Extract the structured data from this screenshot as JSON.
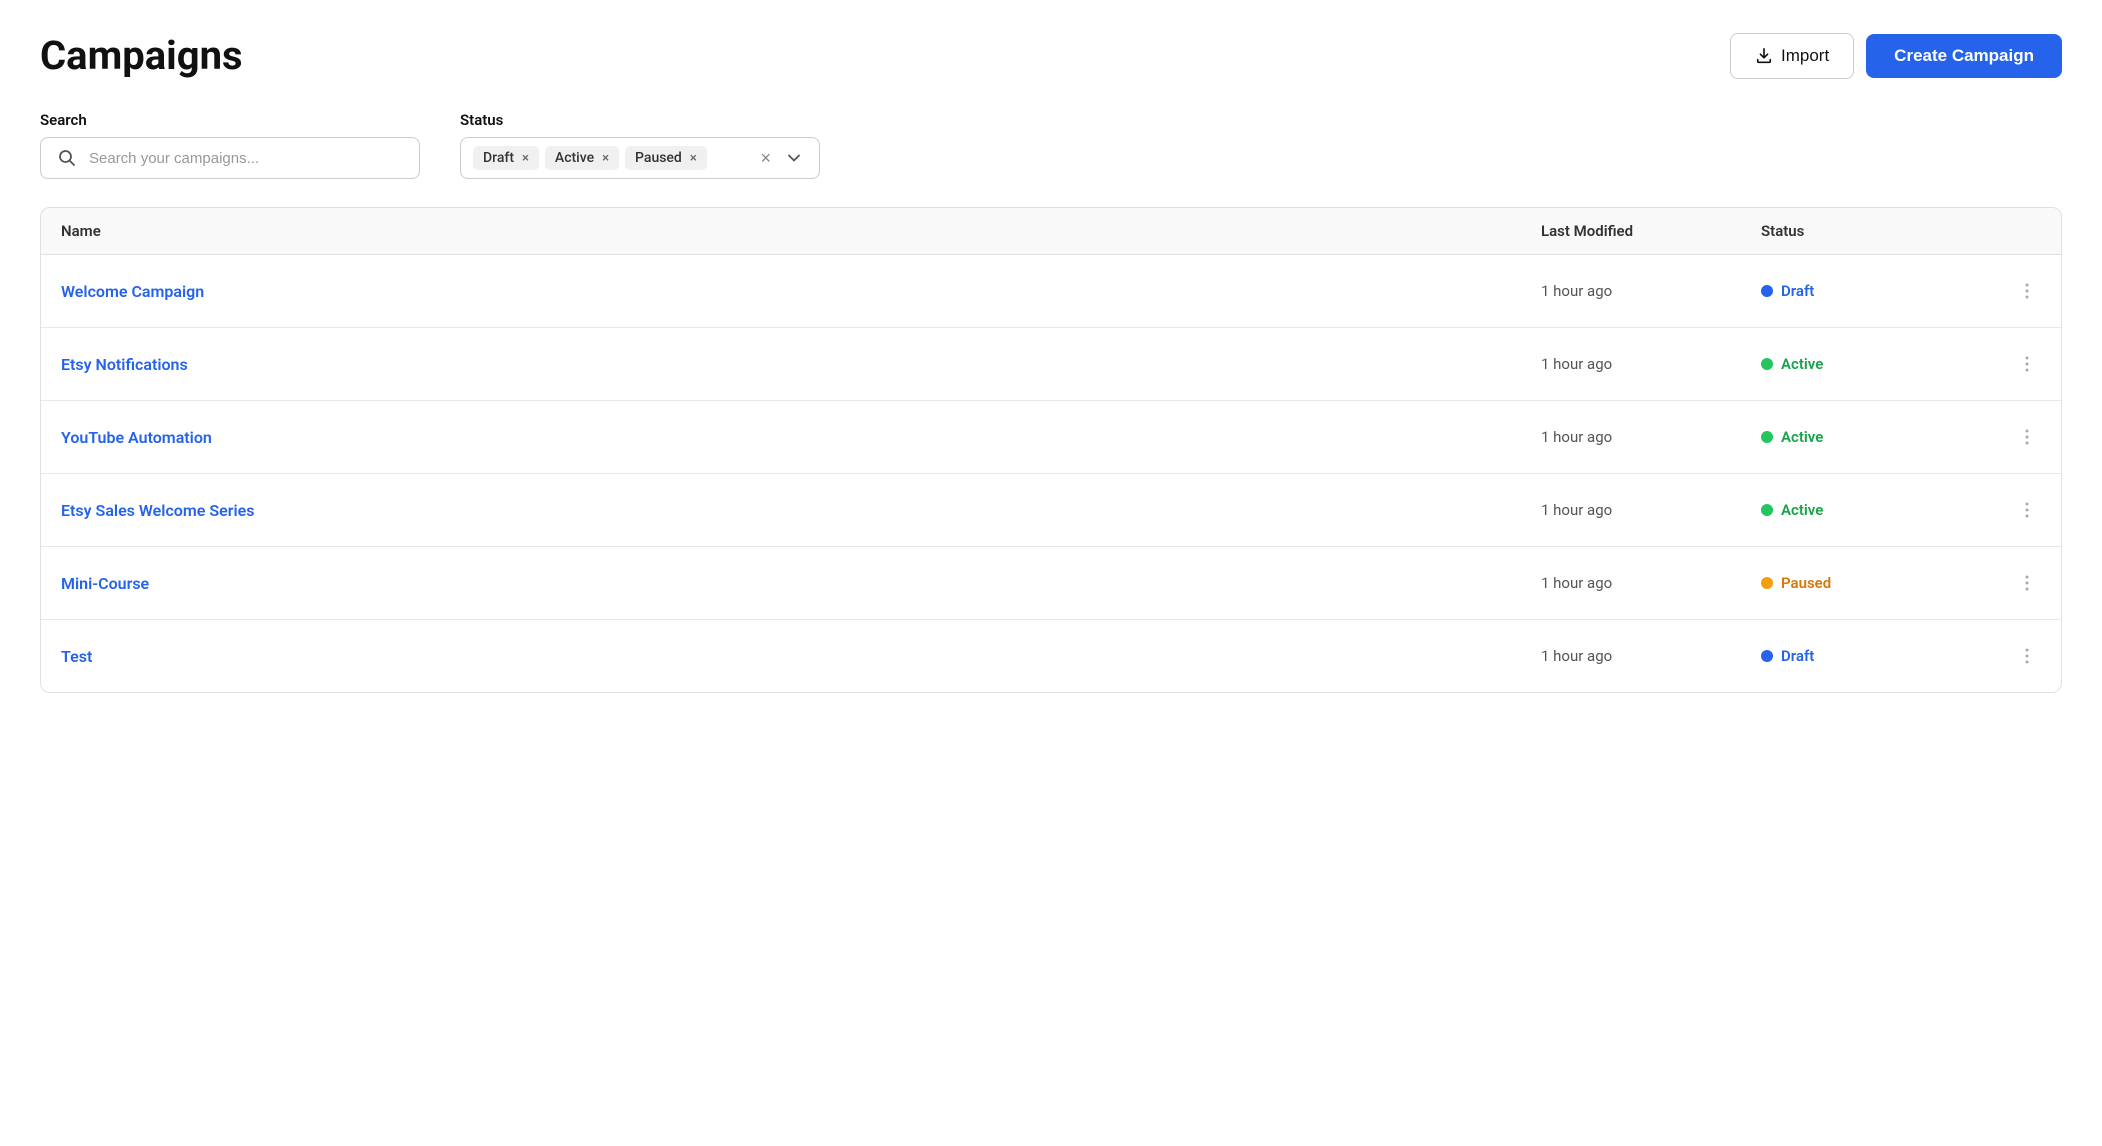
{
  "header": {
    "title": "Campaigns",
    "import_label": "Import",
    "create_label": "Create Campaign"
  },
  "filters": {
    "search_label": "Search",
    "search_placeholder": "Search your campaigns...",
    "status_label": "Status",
    "status_tags": [
      {
        "label": "Draft",
        "value": "draft"
      },
      {
        "label": "Active",
        "value": "active"
      },
      {
        "label": "Paused",
        "value": "paused"
      }
    ]
  },
  "table": {
    "columns": [
      "Name",
      "Last Modified",
      "Status"
    ],
    "rows": [
      {
        "name": "Welcome Campaign",
        "last_modified": "1 hour ago",
        "status": "Draft",
        "status_class": "draft"
      },
      {
        "name": "Etsy Notifications",
        "last_modified": "1 hour ago",
        "status": "Active",
        "status_class": "active"
      },
      {
        "name": "YouTube Automation",
        "last_modified": "1 hour ago",
        "status": "Active",
        "status_class": "active"
      },
      {
        "name": "Etsy Sales Welcome Series",
        "last_modified": "1 hour ago",
        "status": "Active",
        "status_class": "active"
      },
      {
        "name": "Mini-Course",
        "last_modified": "1 hour ago",
        "status": "Paused",
        "status_class": "paused"
      },
      {
        "name": "Test",
        "last_modified": "1 hour ago",
        "status": "Draft",
        "status_class": "draft"
      }
    ]
  }
}
